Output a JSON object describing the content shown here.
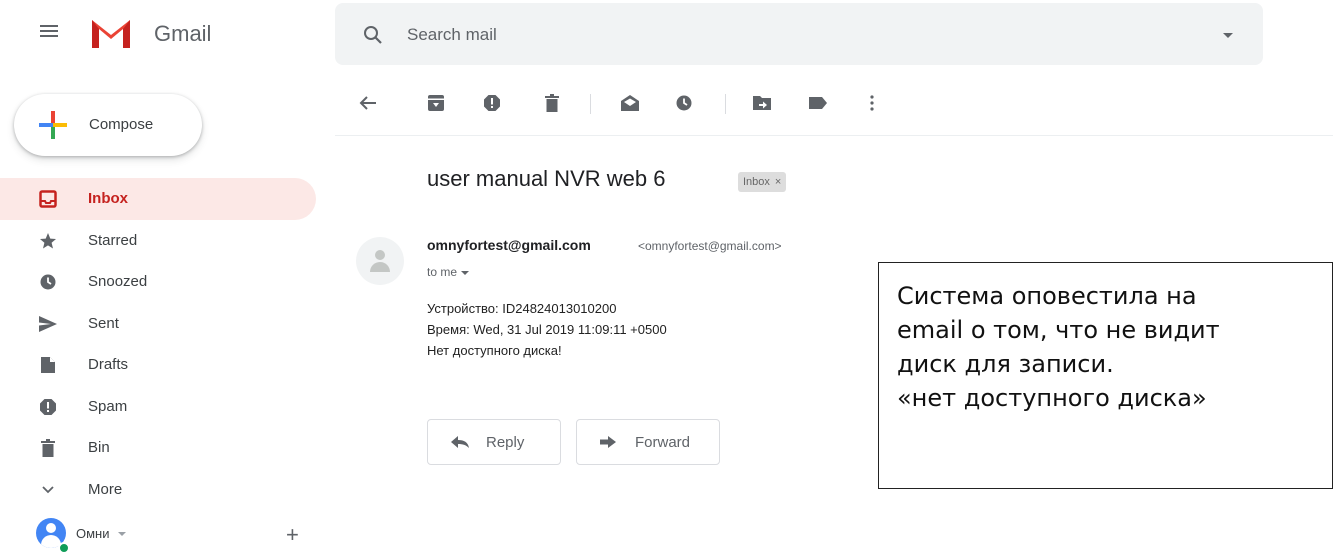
{
  "header": {
    "app_name": "Gmail",
    "search_placeholder": "Search mail"
  },
  "sidebar": {
    "compose_label": "Compose",
    "items": [
      {
        "label": "Inbox",
        "icon": "inbox-icon",
        "active": true
      },
      {
        "label": "Starred",
        "icon": "star-icon"
      },
      {
        "label": "Snoozed",
        "icon": "clock-icon"
      },
      {
        "label": "Sent",
        "icon": "send-icon"
      },
      {
        "label": "Drafts",
        "icon": "draft-icon"
      },
      {
        "label": "Spam",
        "icon": "spam-icon"
      },
      {
        "label": "Bin",
        "icon": "trash-icon"
      },
      {
        "label": "More",
        "icon": "chevron-down-icon"
      }
    ],
    "account_name": "Омни"
  },
  "message": {
    "subject": "user manual NVR web 6",
    "label_chip": "Inbox",
    "label_chip_close": "×",
    "sender_name": "omnyfortest@gmail.com",
    "sender_email": "<omnyfortest@gmail.com>",
    "to": "to me",
    "body_lines": [
      "Устройство: ID24824013010200",
      "Время: Wed, 31 Jul 2019 11:09:11 +0500",
      "Нет доступного диска!"
    ],
    "reply_label": "Reply",
    "forward_label": "Forward"
  },
  "annotation": {
    "lines": [
      "Система оповестила на",
      "email о том, что не видит",
      "диск для записи.",
      "«нет доступного диска»"
    ]
  },
  "colors": {
    "accent_red": "#c5221f",
    "active_bg": "#fce8e6",
    "icon_grey": "#5f6368"
  }
}
